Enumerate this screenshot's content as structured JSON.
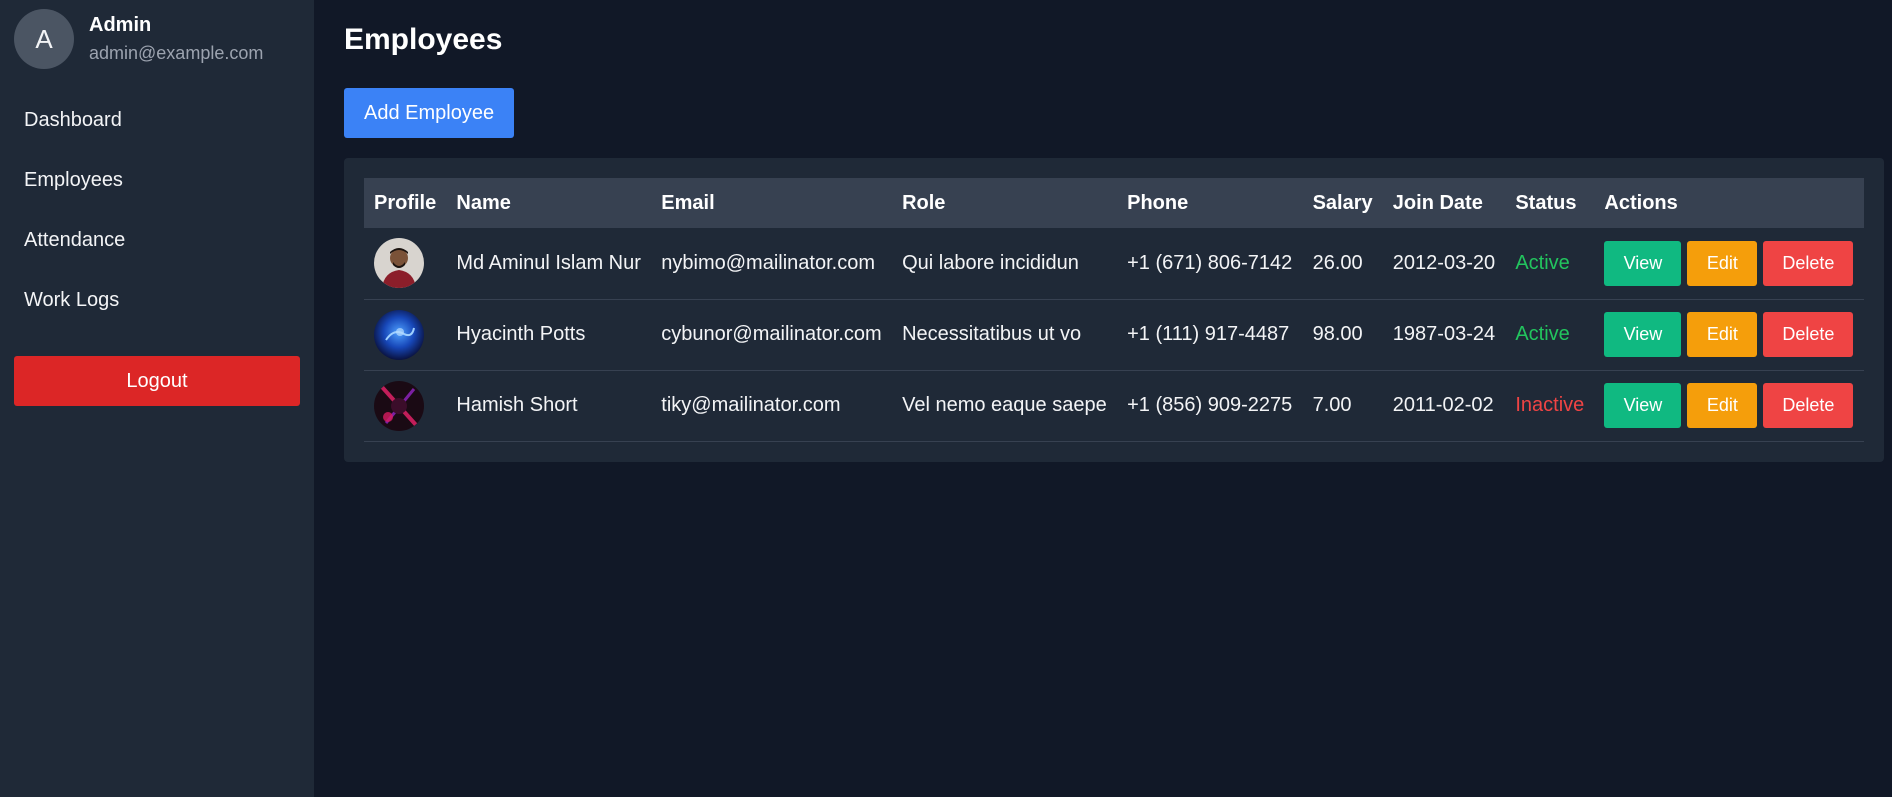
{
  "sidebar": {
    "avatar_letter": "A",
    "user_name": "Admin",
    "user_email": "admin@example.com",
    "nav": [
      "Dashboard",
      "Employees",
      "Attendance",
      "Work Logs"
    ],
    "logout_label": "Logout"
  },
  "main": {
    "title": "Employees",
    "add_button_label": "Add Employee",
    "table": {
      "headers": [
        "Profile",
        "Name",
        "Email",
        "Role",
        "Phone",
        "Salary",
        "Join Date",
        "Status",
        "Actions"
      ],
      "rows": [
        {
          "name": "Md Aminul Islam Nur",
          "email": "nybimo@mailinator.com",
          "role": "Qui labore incididun",
          "phone": "+1 (671) 806-7142",
          "salary": "26.00",
          "join_date": "2012-03-20",
          "status": "Active"
        },
        {
          "name": "Hyacinth Potts",
          "email": "cybunor@mailinator.com",
          "role": "Necessitatibus ut vo",
          "phone": "+1 (111) 917-4487",
          "salary": "98.00",
          "join_date": "1987-03-24",
          "status": "Active"
        },
        {
          "name": "Hamish Short",
          "email": "tiky@mailinator.com",
          "role": "Vel nemo eaque saepe",
          "phone": "+1 (856) 909-2275",
          "salary": "7.00",
          "join_date": "2011-02-02",
          "status": "Inactive"
        }
      ],
      "action_labels": {
        "view": "View",
        "edit": "Edit",
        "delete": "Delete"
      }
    }
  },
  "colors": {
    "page_bg": "#111827",
    "sidebar_bg": "#1f2937",
    "primary": "#3b82f6",
    "danger": "#dc2626",
    "success": "#10b981",
    "warning": "#f59e0b",
    "active_text": "#22c55e",
    "inactive_text": "#ef4444"
  }
}
